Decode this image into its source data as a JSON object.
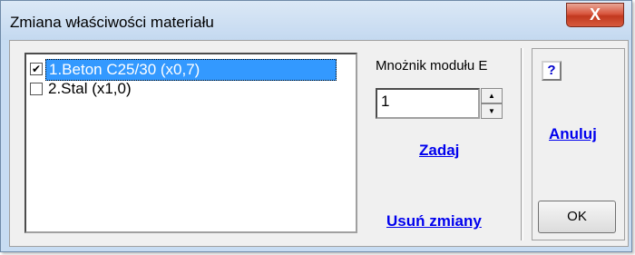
{
  "window": {
    "title": "Zmiana właściwości materiału",
    "close_label": "X"
  },
  "materials": [
    {
      "label": "1.Beton C25/30 (x0,7)",
      "checked": true,
      "selected": true,
      "check_mark": "✔"
    },
    {
      "label": "2.Stal (x1,0)",
      "checked": false,
      "selected": false,
      "check_mark": ""
    }
  ],
  "multiplier": {
    "label": "Mnożnik modułu E",
    "value": "1",
    "up": "▲",
    "down": "▼"
  },
  "actions": {
    "set_label": "Zadaj",
    "remove_label": "Usuń zmiany",
    "cancel_label": "Anuluj",
    "ok_label": "OK",
    "help_label": "?"
  },
  "colors": {
    "selection": "#3399ff",
    "link": "#0000ee",
    "close": "#c2391f"
  }
}
